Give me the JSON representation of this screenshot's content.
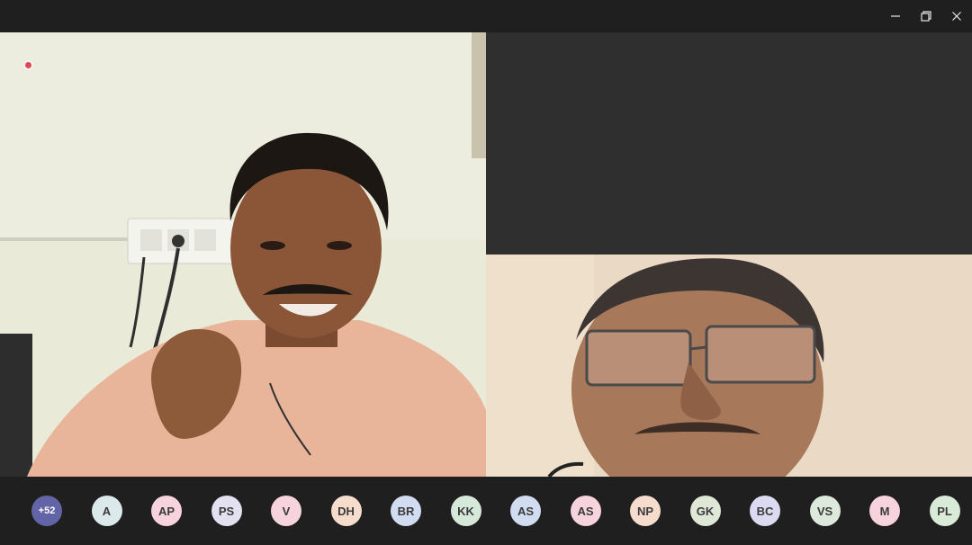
{
  "window": {
    "minimize_icon": "minimize-icon",
    "restore_icon": "restore-icon",
    "close_icon": "close-icon"
  },
  "recording_indicator": {
    "color": "#e2474f"
  },
  "participants": {
    "overflow_label": "+52",
    "overflow_color": "#6264a7",
    "items": [
      {
        "initials": "A",
        "color": "#dce9ea"
      },
      {
        "initials": "AP",
        "color": "#f7d3de"
      },
      {
        "initials": "PS",
        "color": "#e3e0ef"
      },
      {
        "initials": "V",
        "color": "#f7d3de"
      },
      {
        "initials": "DH",
        "color": "#f6dccc"
      },
      {
        "initials": "BR",
        "color": "#d2dcf0"
      },
      {
        "initials": "KK",
        "color": "#d6e8d9"
      },
      {
        "initials": "AS",
        "color": "#d2dcf0"
      },
      {
        "initials": "AS",
        "color": "#f7d3de"
      },
      {
        "initials": "NP",
        "color": "#f6dccc"
      },
      {
        "initials": "GK",
        "color": "#dfe7d6"
      },
      {
        "initials": "BC",
        "color": "#dcdaf0"
      },
      {
        "initials": "VS",
        "color": "#dde9dc"
      },
      {
        "initials": "M",
        "color": "#f7d3de"
      },
      {
        "initials": "PL",
        "color": "#d9ead8"
      }
    ]
  }
}
